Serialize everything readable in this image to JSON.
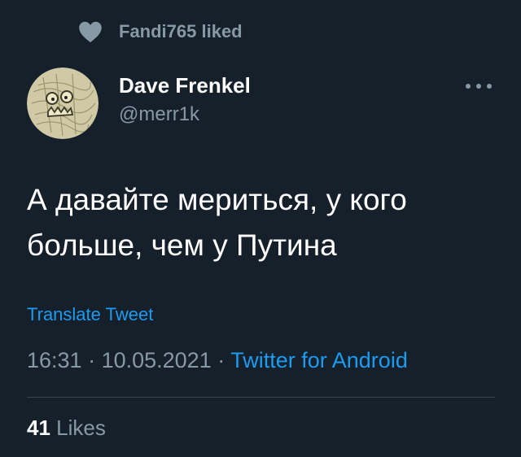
{
  "social_context": {
    "icon": "heart-icon",
    "text": "Fandi765 liked"
  },
  "author": {
    "name": "Dave Frenkel",
    "handle": "@merr1k",
    "avatar": "avatar"
  },
  "more_icon": "ellipsis-icon",
  "tweet": {
    "text": "А давайте мериться, у кого\nбольше, чем у Путина"
  },
  "translate_label": "Translate Tweet",
  "meta": {
    "time": "16:31",
    "sep1": " · ",
    "date": "10.05.2021",
    "sep2": " · ",
    "source": "Twitter for Android"
  },
  "likes": {
    "count": "41",
    "label": "Likes"
  },
  "colors": {
    "background": "#15202b",
    "secondary_text": "#8899a6",
    "link": "#1d9bf0",
    "divider": "#38444d"
  }
}
